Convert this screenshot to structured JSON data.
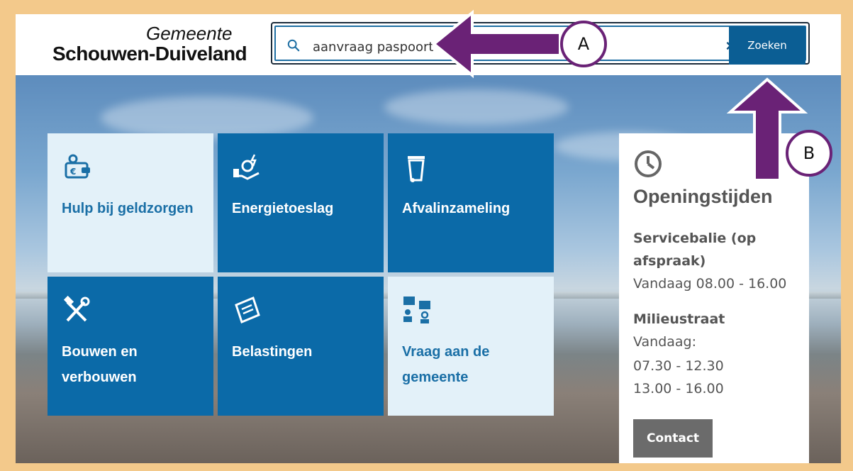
{
  "logo": {
    "line1": "Gemeente",
    "line2": "Schouwen-Duiveland"
  },
  "search": {
    "value": "aanvraag paspoort",
    "clear_label": "×",
    "button_label": "Zoeken"
  },
  "tiles": [
    {
      "label": "Hulp bij geldzorgen",
      "icon": "wallet-euro-icon",
      "style": "light"
    },
    {
      "label": "Energietoeslag",
      "icon": "hand-energy-icon",
      "style": "dark"
    },
    {
      "label": "Afvalinzameling",
      "icon": "trash-bin-icon",
      "style": "dark"
    },
    {
      "label": "Bouwen en verbouwen",
      "icon": "hammer-wrench-icon",
      "style": "dark"
    },
    {
      "label": "Belastingen",
      "icon": "tax-form-icon",
      "style": "dark"
    },
    {
      "label": "Vraag aan de gemeente",
      "icon": "people-chat-icon",
      "style": "light"
    }
  ],
  "hours": {
    "title": "Openingstijden",
    "service_line1": "Servicebalie (op",
    "service_line2": "afspraak)",
    "service_today": "Vandaag 08.00 - 16.00",
    "mileu_title": "Milieustraat",
    "mileu_today": "Vandaag:",
    "mileu_time1": "07.30 - 12.30",
    "mileu_time2": "13.00 - 16.00",
    "contact_label": "Contact"
  },
  "annotations": {
    "a_label": "A",
    "b_label": "B"
  },
  "colors": {
    "brand_blue": "#0b6aa8",
    "light_tile": "#e3f1f9",
    "annotation_purple": "#6a2276",
    "frame": "#f3c98b"
  }
}
